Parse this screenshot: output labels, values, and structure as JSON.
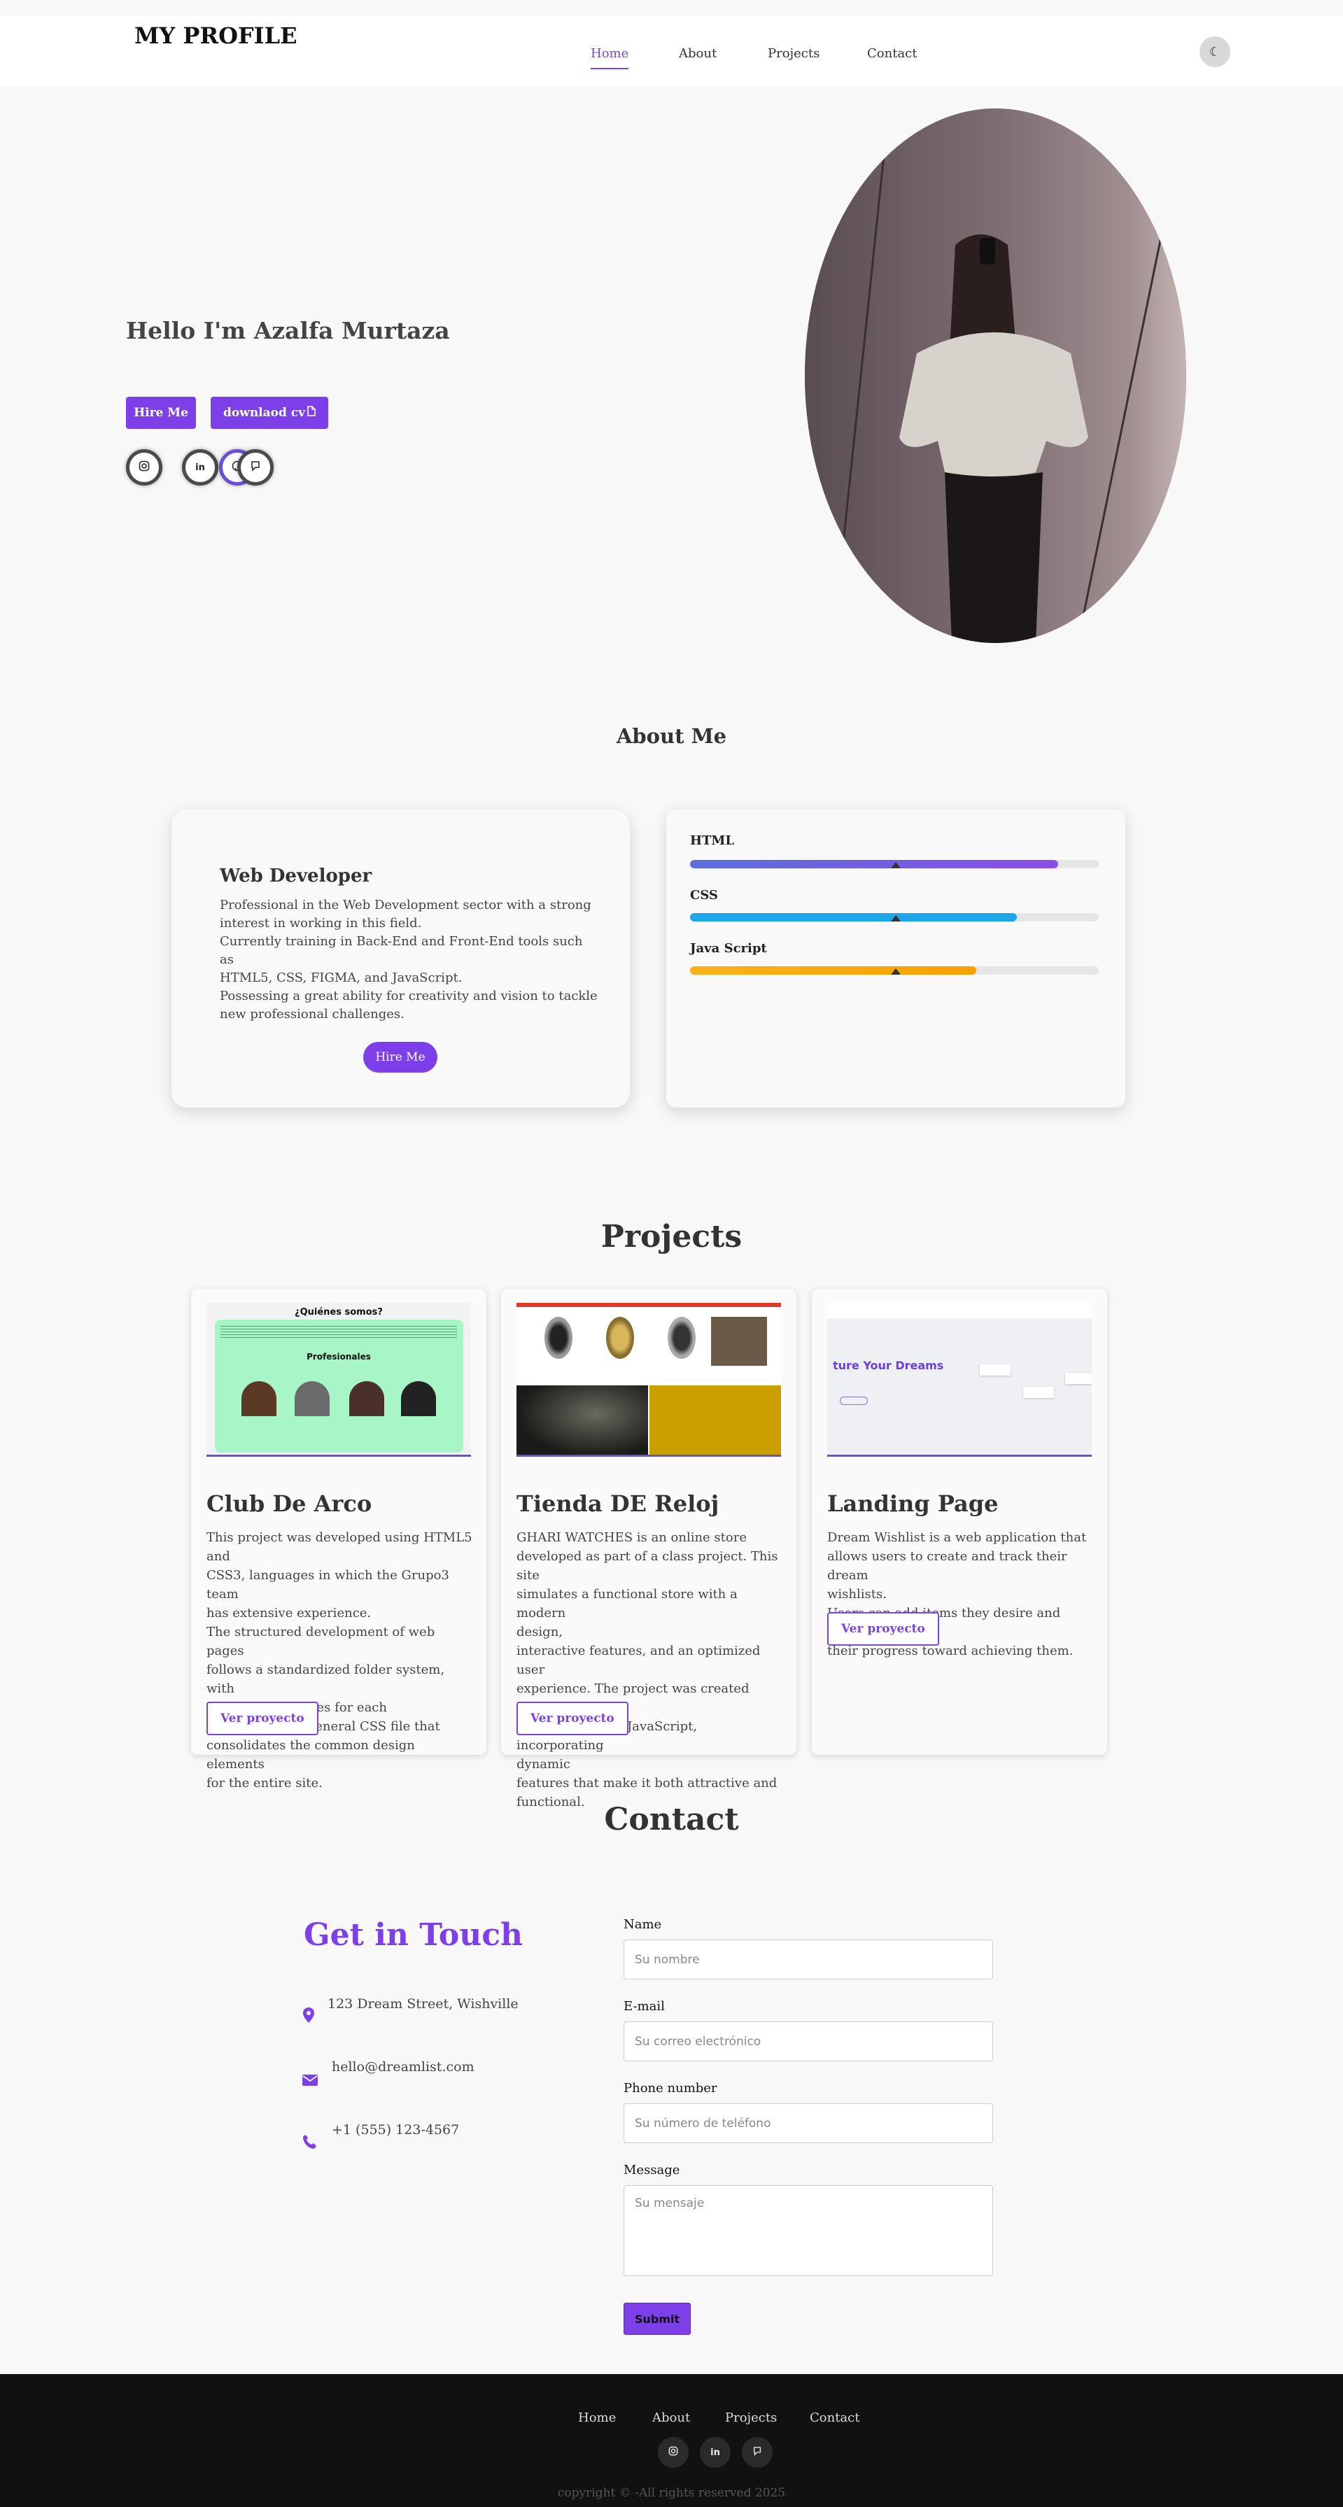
{
  "header": {
    "brand": "MY PROFILE",
    "nav": [
      {
        "label": "Home",
        "active": true
      },
      {
        "label": "About",
        "active": false
      },
      {
        "label": "Projects",
        "active": false
      },
      {
        "label": "Contact",
        "active": false
      }
    ],
    "theme_icon": "moon-icon"
  },
  "hero": {
    "greeting": "Hello I'm Azalfa Murtaza",
    "hire_label": "Hire Me",
    "cv_label": "downlaod cv",
    "cv_icon": "file-icon",
    "socials": [
      "instagram-icon",
      "linkedin-icon",
      "github-icon"
    ]
  },
  "about": {
    "title": "About Me",
    "role": "Web Developer",
    "description": "Professional in the Web Development sector with a strong\ninterest in working in this field.\nCurrently training in Back-End and Front-End tools such as\nHTML5, CSS, FIGMA, and JavaScript.\nPossessing a great ability for creativity and vision to tackle\nnew professional challenges.",
    "hire_label": "Hire Me",
    "skills": [
      {
        "name": "HTML",
        "level": 90,
        "color_from": "#5b6fdc",
        "color_to": "#8a4de6"
      },
      {
        "name": "CSS",
        "level": 80,
        "color_from": "#1ea7e8",
        "color_to": "#1ea7e8"
      },
      {
        "name": "Java Script",
        "level": 70,
        "color_from": "#f7b21a",
        "color_to": "#f7a100"
      }
    ]
  },
  "projects": {
    "title": "Projects",
    "items": [
      {
        "name": "Club De Arco",
        "description": "This project was developed using HTML5 and\nCSS3, languages in which the Grupo3 team\nhas extensive experience.\nThe structured development of web pages\nfollows a standardized folder system, with\nindividual CSS files for each\nwebpage and a general CSS file that\nconsolidates the common design elements\nfor the entire site.",
        "button": "Ver proyecto",
        "thumb": {
          "heading": "¿Quiénes somos?",
          "subheading": "Profesionales"
        }
      },
      {
        "name": "Tienda DE Reloj",
        "description": "GHARI WATCHES is an online store\ndeveloped as part of a class project. This site\nsimulates a functional store with a modern\ndesign,\ninteractive features, and an optimized user\nexperience. The project was created using\nHTML, CSS, and JavaScript, incorporating\ndynamic\nfeatures that make it both attractive and\nfunctional.",
        "button": "Ver proyecto"
      },
      {
        "name": "Landing Page",
        "description": "Dream Wishlist is a web application that\nallows users to create and track their dream\nwishlists.\nUsers can add items they desire and monitor\ntheir progress toward achieving them.",
        "button": "Ver proyecto",
        "thumb": {
          "heading": "ture Your Dreams"
        }
      }
    ]
  },
  "contact": {
    "title": "Contact",
    "heading": "Get in Touch",
    "address": "123 Dream Street, Wishville",
    "email": "hello@dreamlist.com",
    "phone": "+1 (555) 123-4567",
    "icons": [
      "location-icon",
      "mail-icon",
      "phone-icon"
    ],
    "form": {
      "name_label": "Name",
      "name_placeholder": "Su nombre",
      "email_label": "E-mail",
      "email_placeholder": "Su correo electrónico",
      "phone_label": "Phone number",
      "phone_placeholder": "Su número de teléfono",
      "message_label": "Message",
      "message_placeholder": "Su mensaje",
      "submit": "Submit"
    }
  },
  "footer": {
    "links": [
      "Home",
      "About",
      "Projects",
      "Contact"
    ],
    "socials": [
      "instagram-icon",
      "linkedin-icon",
      "github-icon"
    ],
    "copyright": "copyright © -All rights reserved 2025"
  },
  "colors": {
    "accent": "#7c3fe8",
    "background": "#f8f8f8",
    "footer": "#111111"
  }
}
